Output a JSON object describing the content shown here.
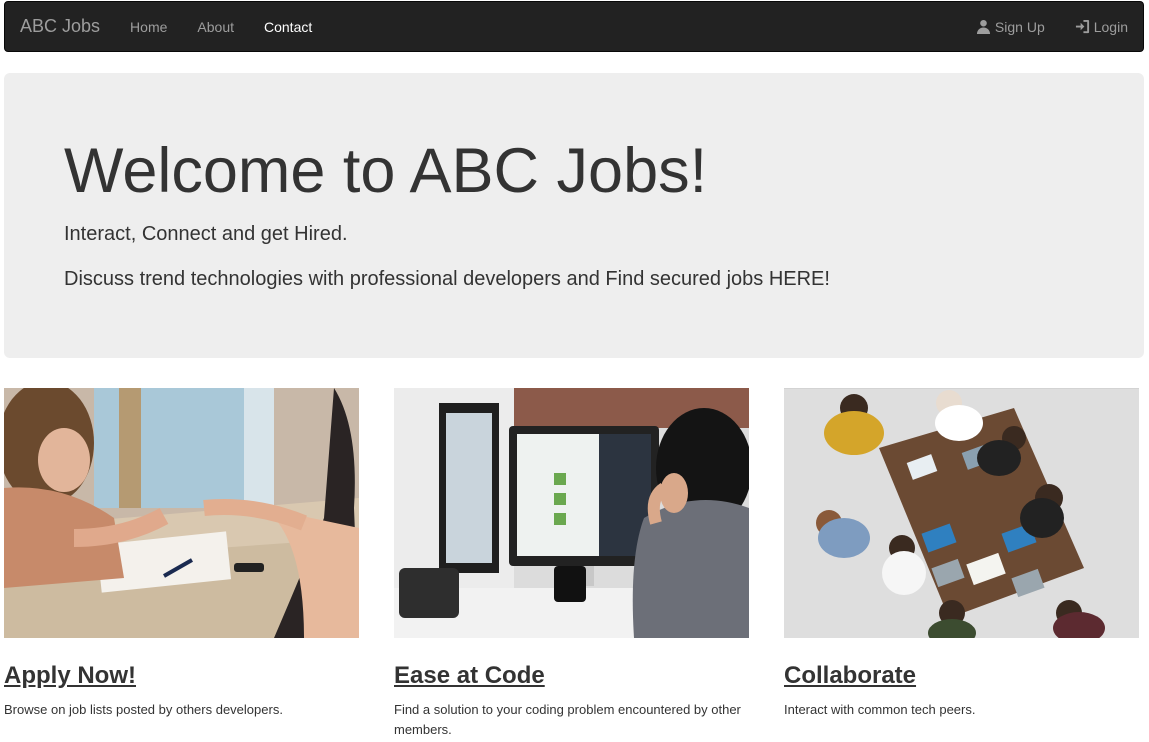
{
  "navbar": {
    "brand": "ABC Jobs",
    "links": [
      {
        "label": "Home",
        "active": false
      },
      {
        "label": "About",
        "active": false
      },
      {
        "label": "Contact",
        "active": true
      }
    ],
    "right_links": [
      {
        "label": "Sign Up",
        "icon": "user-icon"
      },
      {
        "label": "Login",
        "icon": "login-icon"
      }
    ]
  },
  "jumbotron": {
    "title": "Welcome to ABC Jobs!",
    "subtitle": "Interact, Connect and get Hired.",
    "description": "Discuss trend technologies with professional developers and Find secured jobs HERE!"
  },
  "features": [
    {
      "title": "Apply Now!",
      "description": "Browse on job lists posted by others developers.",
      "image": "interview-photo"
    },
    {
      "title": "Ease at Code",
      "description": "Find a solution to your coding problem encountered by other members.",
      "image": "coding-photo"
    },
    {
      "title": "Collaborate",
      "description": "Interact with common tech peers.",
      "image": "meeting-photo"
    }
  ],
  "colors": {
    "navbar_bg": "#222222",
    "nav_text": "#9d9d9d",
    "nav_active": "#ffffff",
    "jumbotron_bg": "#eeeeee",
    "text": "#333333"
  }
}
